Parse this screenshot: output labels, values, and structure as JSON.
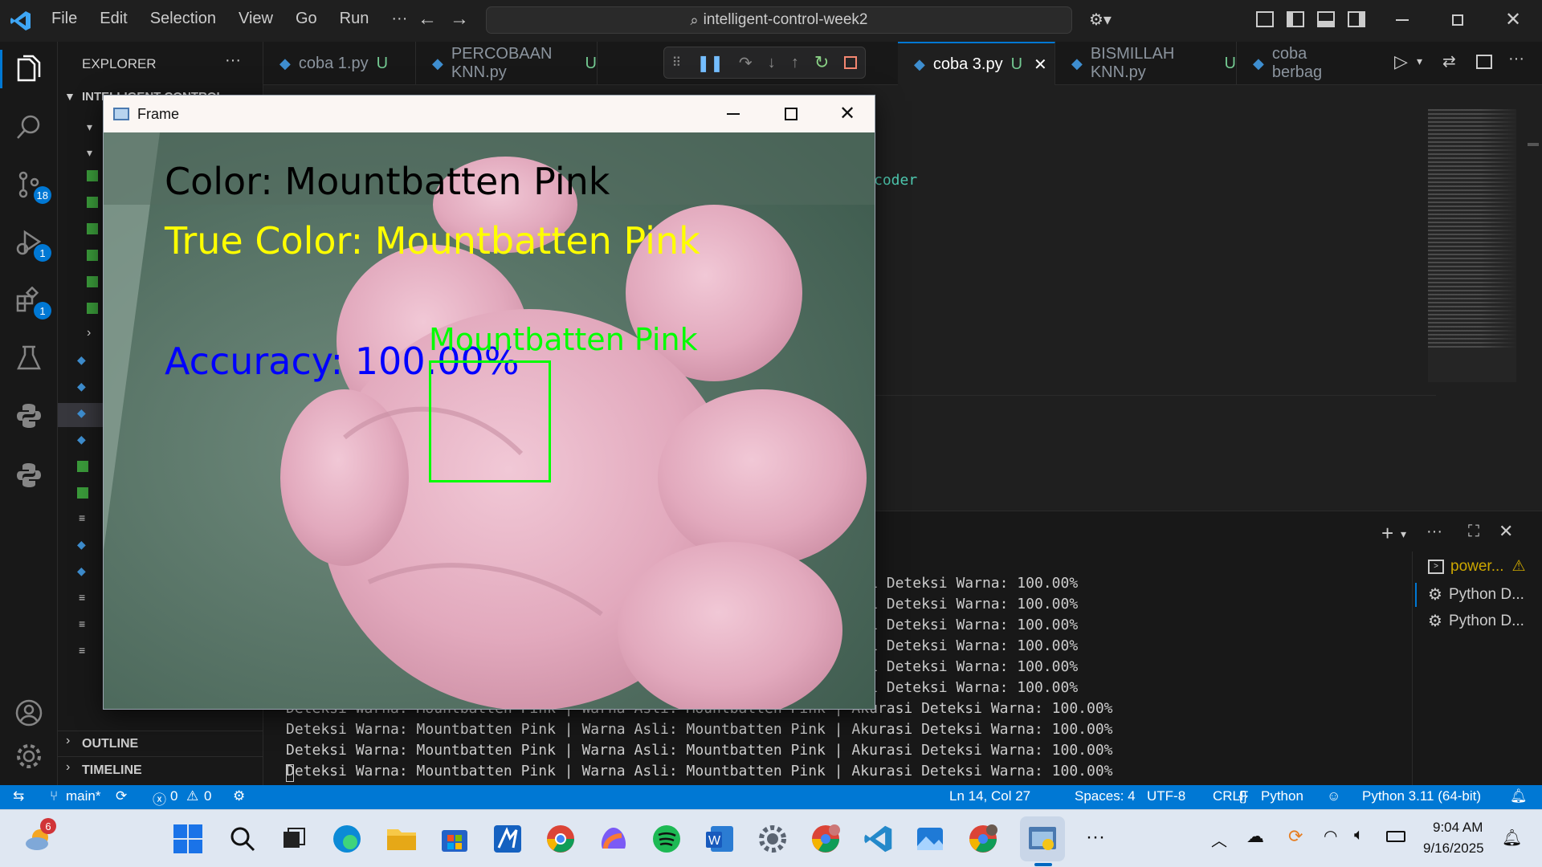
{
  "menu": [
    "File",
    "Edit",
    "Selection",
    "View",
    "Go",
    "Run",
    "···"
  ],
  "command_center": "intelligent-control-week2",
  "explorer": {
    "title": "EXPLORER",
    "project": "INTELLIGENT-CONTROL-...",
    "outline": "OUTLINE",
    "timeline": "TIMELINE"
  },
  "activity_badges": {
    "source_control": "18",
    "run_debug": "1",
    "extensions": "1"
  },
  "tabs": [
    {
      "label": "coba 1.py",
      "status": "U"
    },
    {
      "label": "PERCOBAAN KNN.py",
      "status": "U"
    },
    {
      "label": "coba 3.py",
      "status": "U"
    },
    {
      "label": "BISMILLAH KNN.py",
      "status": "U"
    },
    {
      "label": "coba berbag",
      "status": ""
    }
  ],
  "editor": {
    "visible_code": "coder"
  },
  "terminal": {
    "lines": [
      "                                                             Akurasi Deteksi Warna: 100.00%",
      "                                                             Akurasi Deteksi Warna: 100.00%",
      "                                                             Akurasi Deteksi Warna: 100.00%",
      "                                                             Akurasi Deteksi Warna: 100.00%",
      "                                                             Akurasi Deteksi Warna: 100.00%",
      "                                                             Akurasi Deteksi Warna: 100.00%",
      "Deteksi Warna: Mountbatten Pink | Warna Asli: Mountbatten Pink | Akurasi Deteksi Warna: 100.00%",
      "Deteksi Warna: Mountbatten Pink | Warna Asli: Mountbatten Pink | Akurasi Deteksi Warna: 100.00%",
      "Deteksi Warna: Mountbatten Pink | Warna Asli: Mountbatten Pink | Akurasi Deteksi Warna: 100.00%",
      "Deteksi Warna: Mountbatten Pink | Warna Asli: Mountbatten Pink | Akurasi Deteksi Warna: 100.00%"
    ],
    "sessions": [
      {
        "label": "power...",
        "icon": "terminal-icon"
      },
      {
        "label": "Python D...",
        "icon": "debug-icon"
      },
      {
        "label": "Python D...",
        "icon": "debug-icon"
      }
    ]
  },
  "status": {
    "branch": "main*",
    "errors": "0",
    "warnings": "0",
    "position": "Ln 14, Col 27",
    "spaces": "Spaces: 4",
    "encoding": "UTF-8",
    "eol": "CRLF",
    "language": "Python",
    "interpreter": "Python 3.11 (64-bit)"
  },
  "frame_window": {
    "title": "Frame",
    "color_text": "Color: Mountbatten Pink",
    "true_color_text": "True Color: Mountbatten Pink",
    "accuracy_text": "Accuracy: 100.00%",
    "box_label": "Mountbatten Pink"
  },
  "taskbar": {
    "weather_badge": "6",
    "time": "9:04 AM",
    "date": "9/16/2025"
  },
  "colors": {
    "accent": "#0078d4",
    "overlay_black": "#000000",
    "overlay_yellow": "#ffff00",
    "overlay_blue": "#0000ff",
    "overlay_green": "#00ff00"
  }
}
